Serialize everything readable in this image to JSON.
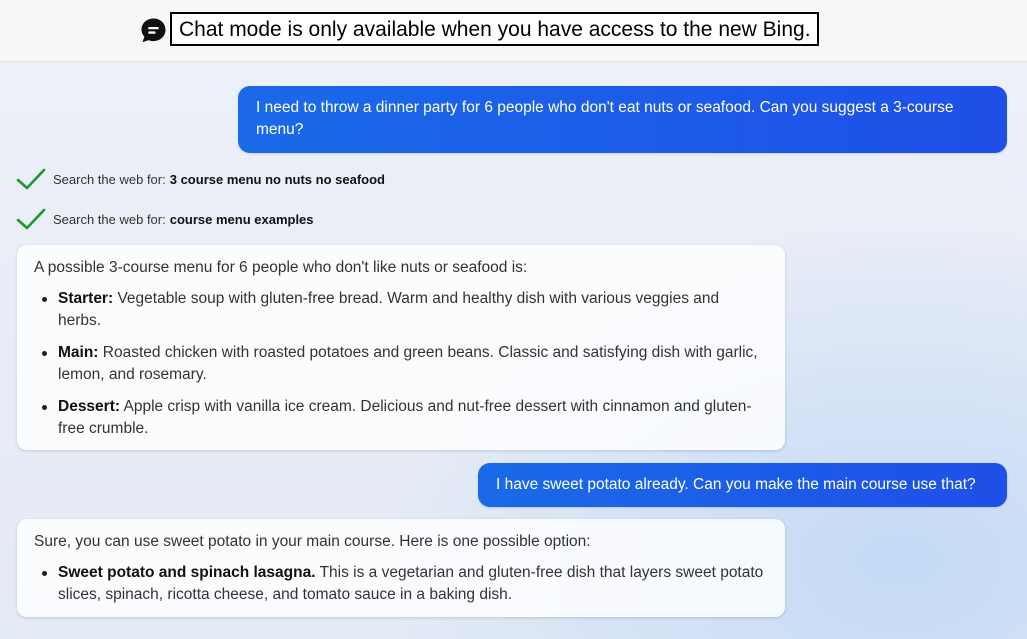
{
  "banner": {
    "icon": "chat-bubble-icon",
    "title": "Chat mode is only available when you have access to the new Bing."
  },
  "messages": {
    "user_1": "I need to throw a dinner party for 6 people who don't eat nuts or seafood. Can you suggest a 3-course menu?",
    "search_1": {
      "icon": "checkmark-icon",
      "prefix": "Search the web for:",
      "query": "3 course menu no nuts no seafood"
    },
    "search_2": {
      "icon": "checkmark-icon",
      "prefix": "Search the web for:",
      "query": "course menu examples"
    },
    "bot_1": {
      "intro": "A possible 3-course menu for 6 people who don't like nuts or seafood is:",
      "items": [
        {
          "label": "Starter:",
          "text": "Vegetable soup with gluten-free bread. Warm and healthy dish with various veggies and herbs."
        },
        {
          "label": "Main:",
          "text": "Roasted chicken with roasted potatoes and green beans. Classic and satisfying dish with garlic, lemon, and rosemary."
        },
        {
          "label": "Dessert:",
          "text": "Apple crisp with vanilla ice cream. Delicious and nut-free dessert with cinnamon and gluten-free crumble."
        }
      ]
    },
    "user_2": "I have sweet potato already. Can you make the main course use that?",
    "bot_2": {
      "intro": "Sure, you can use sweet potato in your main course. Here is one possible option:",
      "items": [
        {
          "label": "Sweet potato and spinach lasagna.",
          "text": "This is a vegetarian and gluten-free dish that layers sweet potato slices, spinach, ricotta cheese, and tomato sauce in a baking dish."
        }
      ]
    }
  },
  "colors": {
    "user_bubble": "#1e5ae8",
    "check": "#1a9a2c",
    "banner_bg": "#f7f7f7"
  }
}
